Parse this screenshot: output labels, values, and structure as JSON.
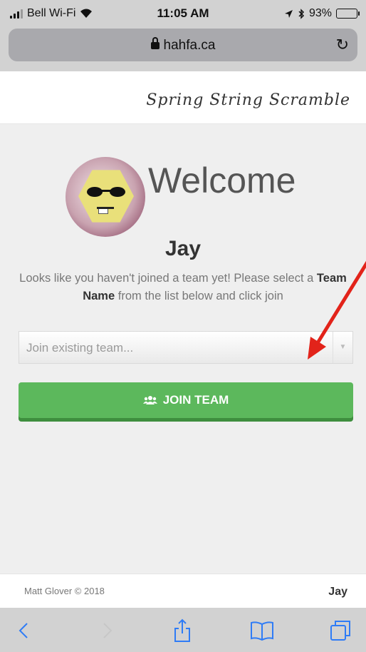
{
  "status": {
    "carrier": "Bell Wi-Fi",
    "time": "11:05 AM",
    "battery": "93%",
    "battery_level": 0.93
  },
  "browser": {
    "url": "hahfa.ca"
  },
  "site": {
    "brand": "Spring String Scramble"
  },
  "main": {
    "welcome": "Welcome",
    "user_name": "Jay",
    "desc_before": "Looks like you haven't joined a team yet! Please select a",
    "desc_bold": "Team Name",
    "desc_after": "from the list below and click join",
    "select_placeholder": "Join existing team...",
    "join_label": "JOIN TEAM"
  },
  "footer": {
    "copyright": "Matt Glover © 2018",
    "user": "Jay"
  },
  "icons": [
    "wifi-icon",
    "location-icon",
    "bluetooth-icon",
    "battery-icon",
    "lock-icon",
    "reload-icon",
    "users-icon",
    "back-icon",
    "forward-icon",
    "share-icon",
    "bookmarks-icon",
    "tabs-icon"
  ],
  "colors": {
    "accent": "#5cb85c",
    "arrow": "#e2231a",
    "toolbar_blue": "#2f7cf6"
  }
}
